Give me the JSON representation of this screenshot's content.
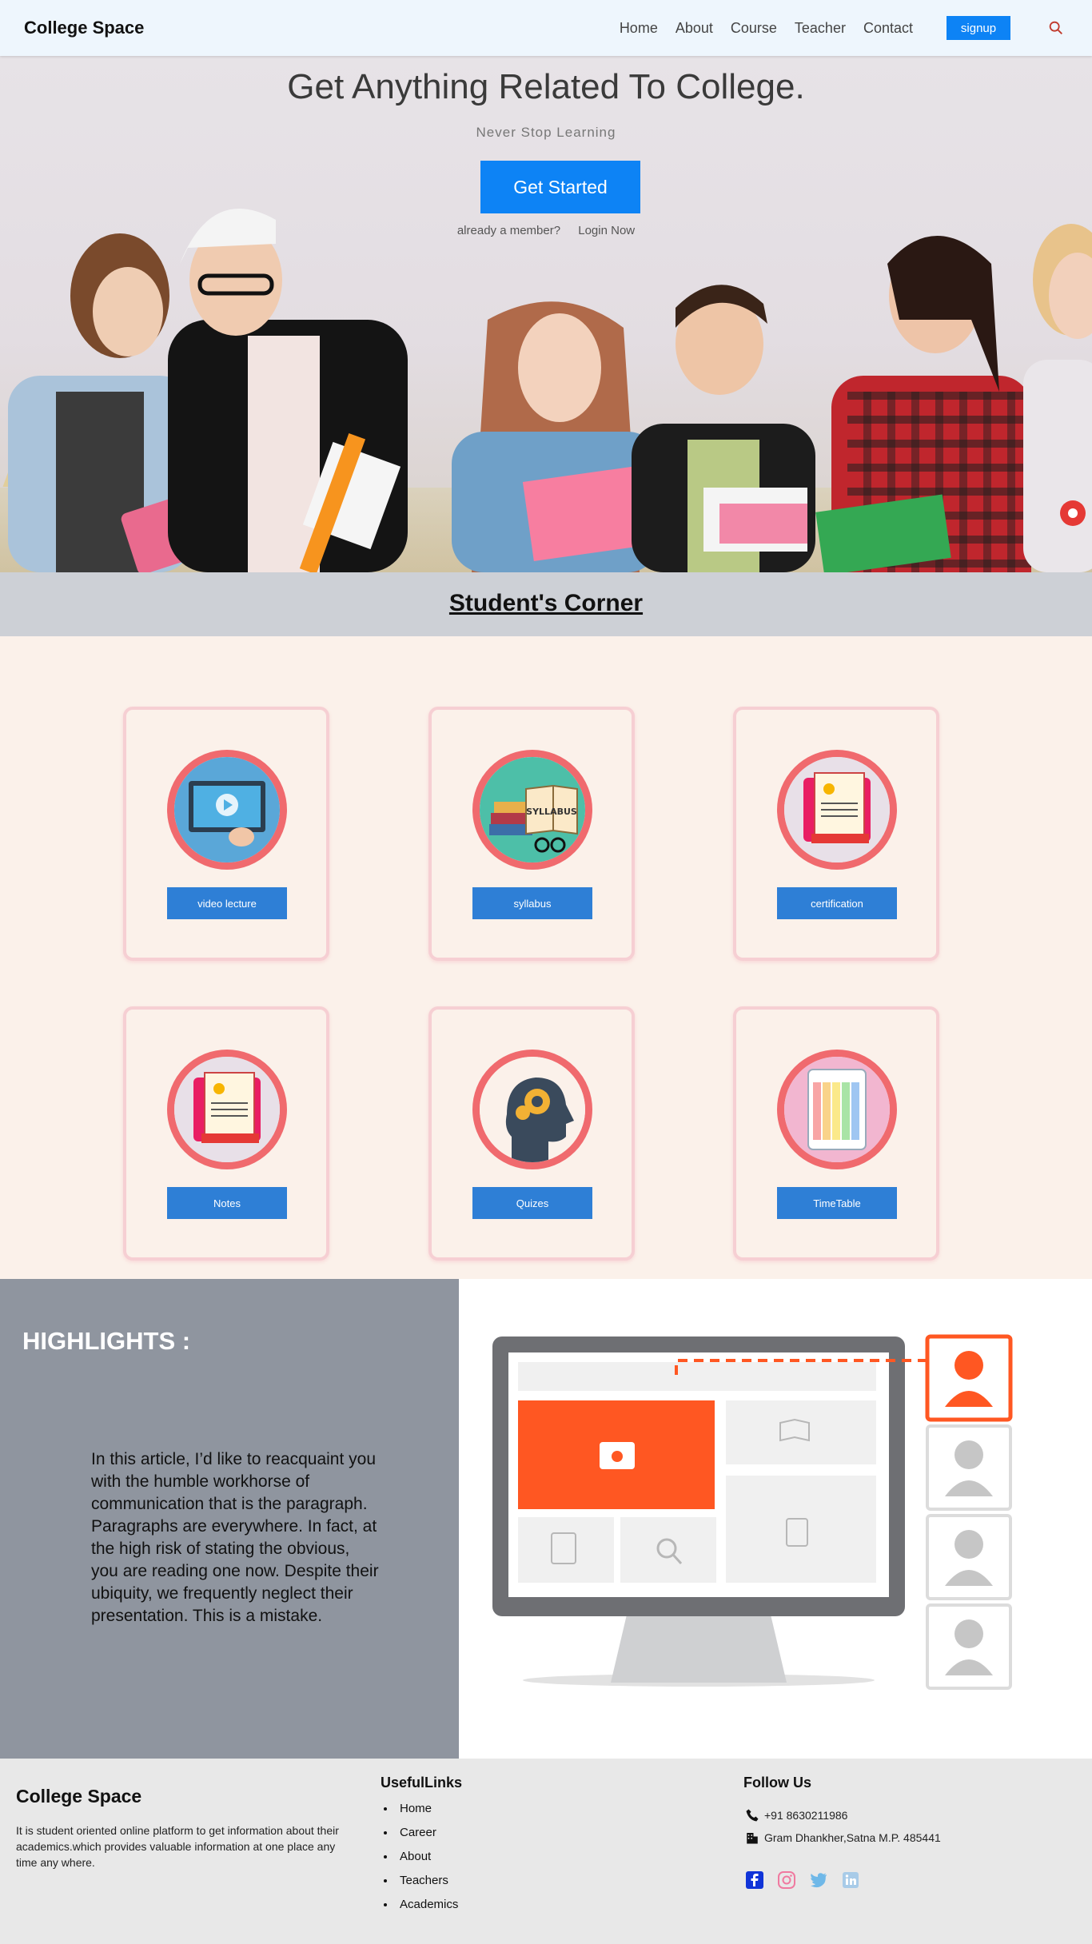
{
  "nav": {
    "brand": "College Space",
    "links": [
      "Home",
      "About",
      "Course",
      "Teacher",
      "Contact"
    ],
    "signup_label": "signup"
  },
  "hero": {
    "title": "Get Anything Related To College.",
    "subtitle": "Never Stop Learning",
    "cta_label": "Get Started",
    "member_text": "already a member?",
    "login_label": "Login Now"
  },
  "corner": {
    "title": "Student's Corner",
    "cards": [
      {
        "label": "video lecture",
        "icon": "video-lecture-icon"
      },
      {
        "label": "syllabus",
        "icon": "syllabus-icon"
      },
      {
        "label": "certification",
        "icon": "certification-icon"
      },
      {
        "label": "Notes",
        "icon": "notes-icon"
      },
      {
        "label": "Quizes",
        "icon": "quiz-brain-icon"
      },
      {
        "label": "TimeTable",
        "icon": "timetable-icon"
      }
    ]
  },
  "highlights": {
    "title": "HIGHLIGHTS :",
    "text": "In this article, I’d like to reacquaint you with the humble workhorse of communication that is the paragraph. Paragraphs are everywhere. In fact, at the high risk of stating the obvious, you are reading one now. Despite their ubiquity, we frequently neglect their presentation. This is a mistake."
  },
  "footer": {
    "brand": "College Space",
    "description": "It is student oriented online platform to get information about their academics.which provides valuable information at one place any time any where.",
    "links_title": "UsefulLinks",
    "links": [
      "Home",
      "Career",
      "About",
      "Teachers",
      "Academics"
    ],
    "follow_title": "Follow Us",
    "phone": "+91 8630211986",
    "address": "Gram Dhankher,Satna M.P. 485441",
    "social": [
      "facebook-icon",
      "instagram-icon",
      "twitter-icon",
      "linkedin-icon"
    ]
  },
  "colors": {
    "accent_blue": "#0d83f5",
    "card_button": "#2e7fd6",
    "card_ring": "#f06a6e",
    "highlight_orange": "#ff5722",
    "highlights_panel": "#8f959f",
    "corner_bg": "#fbf1ea"
  }
}
